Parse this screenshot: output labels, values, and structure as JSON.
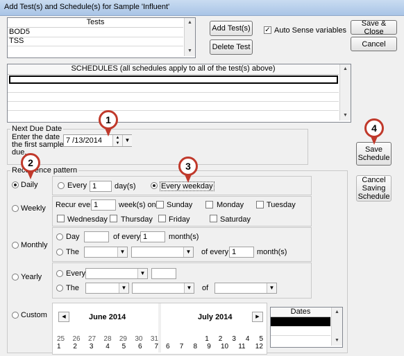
{
  "window": {
    "title": "Add Test(s) and Schedule(s) for Sample 'Influent'"
  },
  "tests": {
    "header": "Tests",
    "items": [
      "BOD5",
      "TSS"
    ]
  },
  "buttons": {
    "add_tests": "Add Test(s)",
    "delete_test": "Delete Test",
    "save_close": "Save & Close",
    "cancel": "Cancel",
    "save_schedule": [
      "Save",
      "Schedule"
    ],
    "cancel_saving": [
      "Cancel",
      "Saving",
      "Schedule"
    ]
  },
  "auto_sense": {
    "label": "Auto Sense variables",
    "checked": true
  },
  "schedules": {
    "header": "SCHEDULES (all schedules apply to all of the test(s) above)"
  },
  "next_due": {
    "legend": "Next Due Date",
    "prompt": [
      "Enter the date",
      "the first sample is",
      "due."
    ],
    "date": "7 /13/2014"
  },
  "recurrence": {
    "legend": "Recurrence pattern",
    "types": [
      "Daily",
      "Weekly",
      "Monthly",
      "Yearly",
      "Custom"
    ],
    "selected": "Daily",
    "daily": {
      "every": "Every",
      "days_value": "1",
      "days_unit": "day(s)",
      "weekday": "Every weekday"
    },
    "weekly": {
      "recur_every": "Recur every",
      "value": "1",
      "unit": "week(s) on:",
      "days": [
        "Sunday",
        "Monday",
        "Tuesday",
        "Wednesday",
        "Thursday",
        "Friday",
        "Saturday"
      ]
    },
    "monthly": {
      "day": "Day",
      "of_every": "of every",
      "value1": "1",
      "months": "month(s)",
      "the": "The",
      "value2": "1"
    },
    "yearly": {
      "every": "Every",
      "the": "The",
      "of": "of"
    },
    "custom": {
      "month1": "June 2014",
      "month2": "July 2014",
      "row1": [
        "25",
        "26",
        "27",
        "28",
        "29",
        "30",
        "31"
      ],
      "row2": [
        "1",
        "2",
        "3",
        "4",
        "5",
        "6",
        "7"
      ],
      "row1b": [
        "1",
        "2",
        "3",
        "4",
        "5"
      ],
      "row2b": [
        "6",
        "7",
        "8",
        "9",
        "10",
        "11",
        "12"
      ],
      "dates_header": "Dates"
    }
  },
  "callouts": [
    "1",
    "2",
    "3",
    "4"
  ]
}
